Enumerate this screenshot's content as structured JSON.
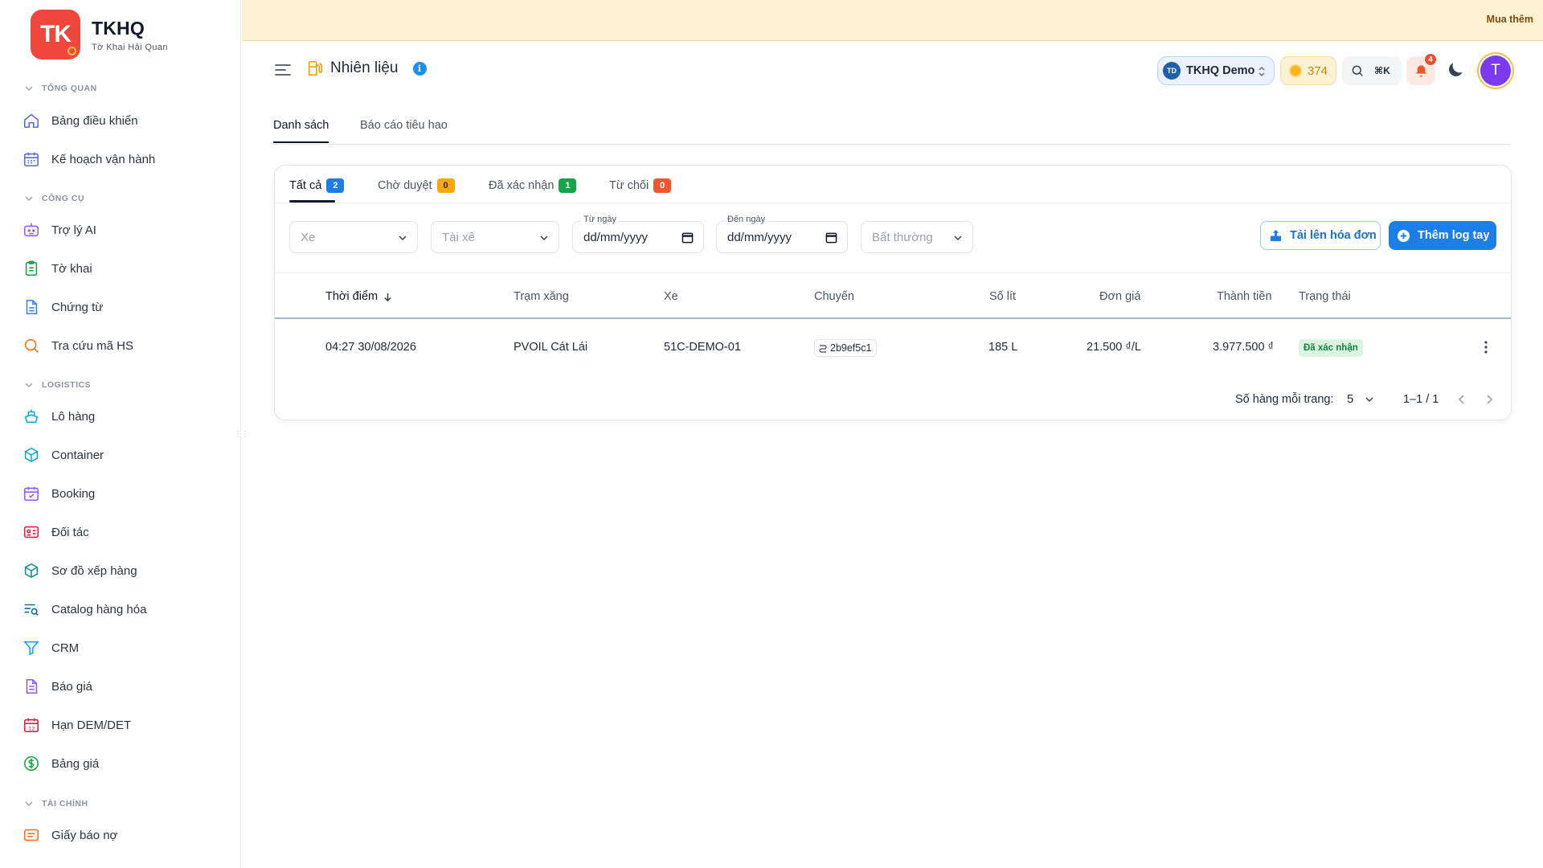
{
  "brand": {
    "logo_text": "TK",
    "name": "TKHQ",
    "subtitle": "Tờ Khai Hải Quan"
  },
  "banner": {
    "link": "Mua thêm"
  },
  "sidebar": {
    "sections": [
      {
        "title": "TỔNG QUAN",
        "items": [
          {
            "label": "Bảng điều khiển",
            "icon": "home-icon"
          },
          {
            "label": "Kế hoạch vận hành",
            "icon": "calendar-grid-icon"
          }
        ]
      },
      {
        "title": "CÔNG CỤ",
        "items": [
          {
            "label": "Trợ lý AI",
            "icon": "bot-icon"
          },
          {
            "label": "Tờ khai",
            "icon": "clipboard-icon"
          },
          {
            "label": "Chứng từ",
            "icon": "document-icon"
          },
          {
            "label": "Tra cứu mã HS",
            "icon": "search-icon"
          }
        ]
      },
      {
        "title": "LOGISTICS",
        "items": [
          {
            "label": "Lô hàng",
            "icon": "ship-icon"
          },
          {
            "label": "Container",
            "icon": "box-icon"
          },
          {
            "label": "Booking",
            "icon": "calendar-check-icon"
          },
          {
            "label": "Đối tác",
            "icon": "id-card-icon"
          },
          {
            "label": "Sơ đồ xếp hàng",
            "icon": "cube-icon"
          },
          {
            "label": "Catalog hàng hóa",
            "icon": "list-search-icon"
          },
          {
            "label": "CRM",
            "icon": "funnel-icon"
          },
          {
            "label": "Báo giá",
            "icon": "file-text-icon"
          },
          {
            "label": "Hạn DEM/DET",
            "icon": "calendar-12-icon"
          },
          {
            "label": "Bảng giá",
            "icon": "dollar-circle-icon"
          }
        ]
      },
      {
        "title": "TÀI CHÍNH",
        "items": [
          {
            "label": "Giấy báo nợ",
            "icon": "receipt-icon"
          }
        ]
      }
    ]
  },
  "header": {
    "title": "Nhiên liệu",
    "org": {
      "avatar": "TD",
      "name": "TKHQ Demo"
    },
    "coins": "374",
    "search_shortcut": "⌘K",
    "notifications": "4",
    "user_initial": "T"
  },
  "main_tabs": [
    {
      "label": "Danh sách"
    },
    {
      "label": "Báo cáo tiêu hao"
    }
  ],
  "status_tabs": [
    {
      "label": "Tất cả",
      "count": "2",
      "color": "#1d7ee8"
    },
    {
      "label": "Chờ duyệt",
      "count": "0",
      "color": "#f5a70b"
    },
    {
      "label": "Đã xác nhận",
      "count": "1",
      "color": "#17a34a"
    },
    {
      "label": "Từ chối",
      "count": "0",
      "color": "#f0562f"
    }
  ],
  "filters": {
    "vehicle_placeholder": "Xe",
    "driver_placeholder": "Tài xế",
    "from_label": "Từ ngày",
    "from_value": "dd/mm/yyyy",
    "to_label": "Đến ngày",
    "to_value": "dd/mm/yyyy",
    "anomaly_placeholder": "Bất thường"
  },
  "actions": {
    "upload": "Tải lên hóa đơn",
    "add": "Thêm log tay"
  },
  "table": {
    "columns": [
      "Thời điểm",
      "Trạm xăng",
      "Xe",
      "Chuyến",
      "Số lít",
      "Đơn giá",
      "Thành tiền",
      "Trạng thái"
    ],
    "rows": [
      {
        "time": "04:27 30/08/2026",
        "station": "PVOIL Cát Lái",
        "vehicle": "51C-DEMO-01",
        "trip": "2b9ef5c1",
        "liters": "185 L",
        "unit_price": "21.500 ₫/L",
        "total": "3.977.500 ₫",
        "status": "Đã xác nhận"
      }
    ]
  },
  "pagination": {
    "label": "Số hàng mỗi trang:",
    "page_size": "5",
    "range": "1–1 / 1"
  },
  "colors": {
    "accent": "#1d7ee8",
    "brand": "#f0473c",
    "banner": "#fdf3d2"
  }
}
